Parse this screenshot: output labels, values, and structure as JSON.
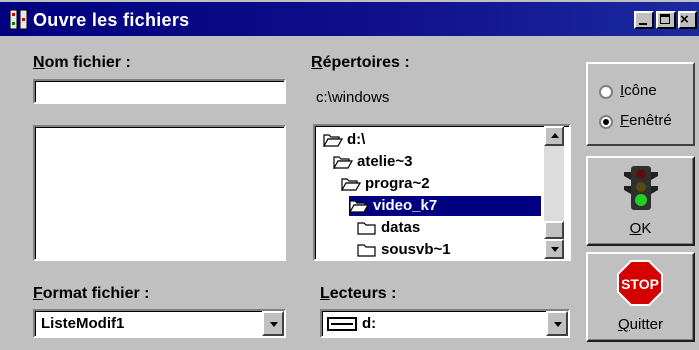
{
  "window": {
    "title": "Ouvre les fichiers"
  },
  "labels": {
    "filename_prefix": "N",
    "filename_rest": "om fichier :",
    "dirs_prefix": "R",
    "dirs_rest": "épertoires :",
    "format_prefix": "F",
    "format_rest": "ormat fichier :",
    "drives_prefix": "L",
    "drives_rest": "ecteurs :"
  },
  "current_path": "c:\\windows",
  "filename_input": {
    "value": ""
  },
  "directories": [
    {
      "name": "d:\\",
      "state": "open",
      "selected": false
    },
    {
      "name": "atelie~3",
      "state": "open",
      "selected": false
    },
    {
      "name": "progra~2",
      "state": "open",
      "selected": false
    },
    {
      "name": "video_k7",
      "state": "open",
      "selected": true
    },
    {
      "name": "datas",
      "state": "closed",
      "selected": false
    },
    {
      "name": "sousvb~1",
      "state": "closed",
      "selected": false
    }
  ],
  "format_select": {
    "value": "ListeModif1"
  },
  "drive_select": {
    "value": "d:"
  },
  "view_options": [
    {
      "prefix": "I",
      "rest": "cône",
      "checked": false
    },
    {
      "prefix": "F",
      "rest": "enêtré",
      "checked": true
    }
  ],
  "buttons": {
    "ok_prefix": "O",
    "ok_rest": "K",
    "quit_prefix": "Q",
    "quit_rest": "uitter",
    "stop_sign_text": "STOP"
  },
  "colors": {
    "titlebar": "#000080",
    "selection": "#000080",
    "face": "#c0c0c0",
    "stop_red": "#d40000"
  },
  "icons": [
    "traffic-light-icon",
    "stop-sign-icon",
    "folder-open-icon",
    "folder-closed-icon",
    "drive-icon"
  ]
}
